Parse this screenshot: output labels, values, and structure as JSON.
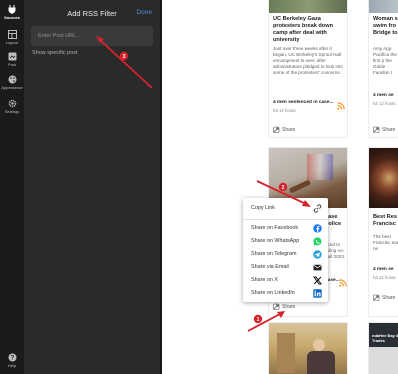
{
  "rail": {
    "items": [
      {
        "label": "Sources",
        "icon": "plug-icon"
      },
      {
        "label": "Layout",
        "icon": "layout-icon"
      },
      {
        "label": "Post",
        "icon": "post-icon"
      },
      {
        "label": "Appearance",
        "icon": "palette-icon"
      },
      {
        "label": "Settings",
        "icon": "gear-icon"
      },
      {
        "label": "Help",
        "icon": "help-icon"
      }
    ]
  },
  "panel": {
    "title": "Add RSS Filter",
    "done_label": "Done",
    "input_placeholder": "Enter Post URL...",
    "show_specific": "Show specific post"
  },
  "cards": {
    "top_mid": {
      "title": "UC Berkeley Gaza protesters break down camp after deal with university",
      "excerpt": "Just over three weeks after it began, UC Berkeley's Sproul Hall encampment is over, after administrators pledged to look into some of the protesters' concerns.",
      "meta": "4 men sentenced in case...",
      "time": "há 12 horas",
      "share": "Share"
    },
    "top_right": {
      "title": "Woman s swim fro Bridge to",
      "excerpt": "Amy App Pacifica the first p the Golde Farallon I",
      "meta": "4 men se",
      "time": "há 12 horas",
      "share": "Share"
    },
    "mid_mid": {
      "title": "case police",
      "excerpt": "nced to nding no- Fall 2023.",
      "meta": "case...",
      "share": "Share"
    },
    "mid_right": {
      "title": "Best Res Francisc",
      "excerpt": "The best Francisc each ne",
      "meta": "4 men se",
      "time": "há 12 horas",
      "share": "Share"
    },
    "bottom_right": {
      "headline": "ndaHee Bay & Trades"
    }
  },
  "share_menu": {
    "items": [
      {
        "label": "Copy Link",
        "icon": "link-icon"
      },
      {
        "label": "Share on Facebook",
        "icon": "facebook-icon",
        "color": "#1877f2"
      },
      {
        "label": "Share on WhatsApp",
        "icon": "whatsapp-icon",
        "color": "#25d366"
      },
      {
        "label": "Share on Telegram",
        "icon": "telegram-icon",
        "color": "#2aa3e0"
      },
      {
        "label": "Share via Email",
        "icon": "email-icon",
        "color": "#222222"
      },
      {
        "label": "Share on X",
        "icon": "x-icon",
        "color": "#111111"
      },
      {
        "label": "Share on LinkedIn",
        "icon": "linkedin-icon",
        "color": "#0a66c2"
      }
    ]
  },
  "annotations": {
    "badges": [
      "1",
      "2",
      "3"
    ],
    "arrow_color": "#d6232b"
  },
  "colors": {
    "rss_orange": "#f7931a",
    "accent_blue": "#4a90e2"
  }
}
